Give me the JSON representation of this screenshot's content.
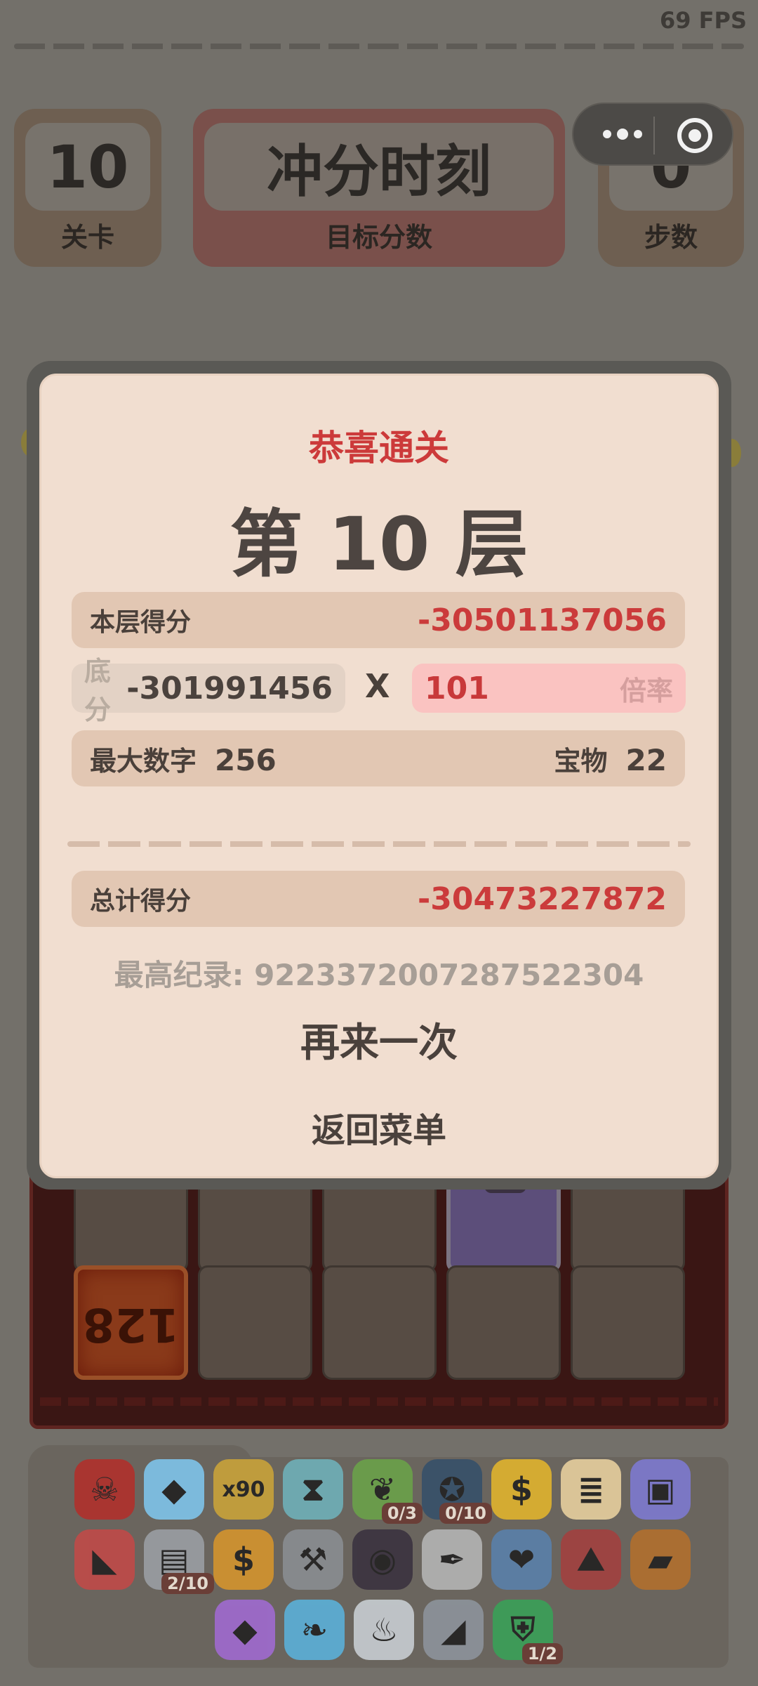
{
  "status": {
    "fps": "69 FPS"
  },
  "hud": {
    "level_value": "10",
    "level_label": "关卡",
    "target_value": "冲分时刻",
    "target_label": "目标分数",
    "steps_value": "0",
    "steps_label": "步数"
  },
  "board": {
    "tile_value": "128"
  },
  "inventory": [
    {
      "icon": "demon-skull-icon",
      "glyph": "☠",
      "color": "#b0302c"
    },
    {
      "icon": "ice-cube-icon",
      "glyph": "◆",
      "color": "#7fc4ea"
    },
    {
      "icon": "x90-ticket-icon",
      "glyph": "x90",
      "color": "#c9a23a"
    },
    {
      "icon": "hourglass-icon",
      "glyph": "⧗",
      "color": "#6fb0b8"
    },
    {
      "icon": "leaf-icon",
      "glyph": "❦",
      "color": "#6aa14a",
      "badge": "0/3"
    },
    {
      "icon": "compass-icon",
      "glyph": "✪",
      "color": "#36506a",
      "badge": "0/10"
    },
    {
      "icon": "gold-coin-icon",
      "glyph": "$",
      "color": "#e0b32e"
    },
    {
      "icon": "scroll-list-icon",
      "glyph": "≣",
      "color": "#e7cf9e"
    },
    {
      "icon": "treasure-chest-icon",
      "glyph": "▣",
      "color": "#7d7ad0"
    },
    {
      "icon": "boot-icon",
      "glyph": "◣",
      "color": "#c04a48"
    },
    {
      "icon": "machine-icon",
      "glyph": "▤",
      "color": "#9a9ea3",
      "badge": "2/10"
    },
    {
      "icon": "coupon-icon",
      "glyph": "$",
      "color": "#d4942e"
    },
    {
      "icon": "axe-icon",
      "glyph": "⚒",
      "color": "#8a8d92"
    },
    {
      "icon": "lens-icon",
      "glyph": "◉",
      "color": "#3b3340"
    },
    {
      "icon": "pen-icon",
      "glyph": "✒",
      "color": "#b4b4b4"
    },
    {
      "icon": "heart-shield-icon",
      "glyph": "❤",
      "color": "#5a80aa"
    },
    {
      "icon": "mountain-shield-icon",
      "glyph": "⛰",
      "color": "#a24140"
    },
    {
      "icon": "chest-icon",
      "glyph": "▰",
      "color": "#b1702e"
    },
    {
      "icon": "crystal-icon",
      "glyph": "◆",
      "color": "#a06ad0"
    },
    {
      "icon": "feather-icon",
      "glyph": "❧",
      "color": "#5bb0d8"
    },
    {
      "icon": "candle-icon",
      "glyph": "♨",
      "color": "#c8cdd2"
    },
    {
      "icon": "iron-boot-icon",
      "glyph": "◢",
      "color": "#8d939b"
    },
    {
      "icon": "green-shield-icon",
      "glyph": "⛨",
      "color": "#3aa058",
      "badge": "1/2"
    }
  ],
  "modal": {
    "title": "恭喜通关",
    "level": "第 10 层",
    "floor_score_label": "本层得分",
    "floor_score_value": "-30501137056",
    "base_label": "底分",
    "base_value": "-301991456",
    "times": "X",
    "multiplier_value": "101",
    "multiplier_label": "倍率",
    "max_number_label": "最大数字",
    "max_number_value": "256",
    "treasure_label": "宝物",
    "treasure_value": "22",
    "total_label": "总计得分",
    "total_value": "-30473227872",
    "best_record": "最高纪录: 9223372007287522304",
    "retry_button": "再来一次",
    "menu_button": "返回菜单"
  }
}
